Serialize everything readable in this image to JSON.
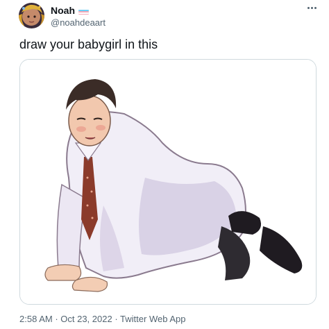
{
  "author": {
    "display_name": "Noah",
    "handle": "@noahdeaart",
    "avatar_icon": "avatar-illustration",
    "badge_icon": "trans-flag-icon",
    "badge_colors": [
      "#5bcefa",
      "#f5a9b8",
      "#ffffff",
      "#f5a9b8",
      "#5bcefa"
    ]
  },
  "more_icon": "more-options-icon",
  "tweet": {
    "text": "draw your babygirl in this"
  },
  "meta": {
    "time": "2:58 AM",
    "separator": " · ",
    "date": "Oct 23, 2022",
    "source": "Twitter Web App"
  },
  "colors": {
    "text_primary": "#0f1419",
    "text_secondary": "#536471",
    "border": "#cfd9de"
  }
}
